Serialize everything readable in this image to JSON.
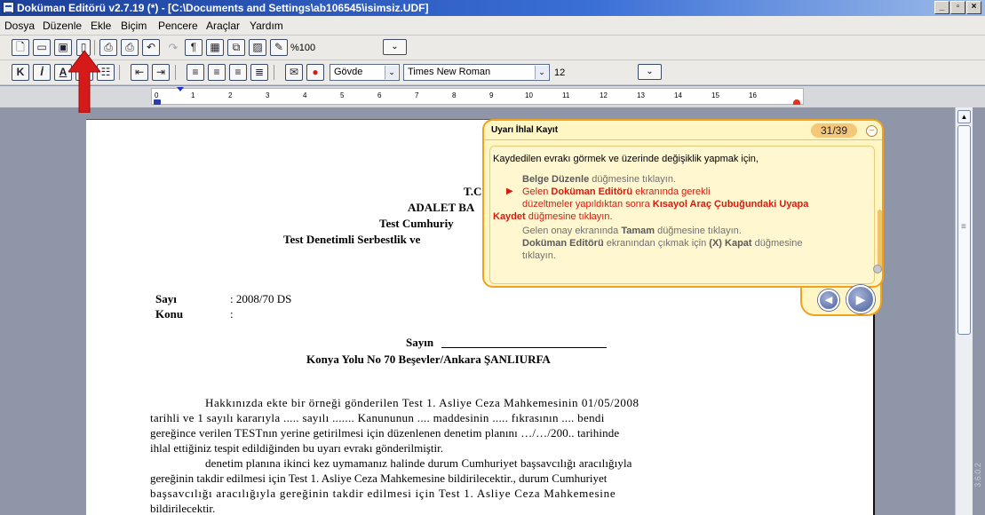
{
  "window": {
    "title": "Doküman Editörü v2.7.19 (*) - [C:\\Documents and Settings\\ab106545\\isimsiz.UDF]",
    "minimize": "_",
    "maximize": "▫",
    "close": "×"
  },
  "menu": [
    "Dosya",
    "Düzenle",
    "Ekle",
    "Biçim",
    "Pencere",
    "Araçlar",
    "Yardım"
  ],
  "toolbar1": {
    "zoom": "%100"
  },
  "toolbar2": {
    "bold": "K",
    "italic": "İ",
    "style_value": "Gövde",
    "font_value": "Times New Roman",
    "size_value": "12"
  },
  "ruler_numbers": [
    "0",
    "1",
    "2",
    "3",
    "4",
    "5",
    "6",
    "7",
    "8",
    "9",
    "10",
    "11",
    "12",
    "13",
    "14",
    "15",
    "16"
  ],
  "document": {
    "header1": "T.C",
    "header2": "ADALET BA",
    "header3": "Test Cumhuriy",
    "header4": "Test Denetimli Serbestlik ve",
    "sayi_label": "Sayı",
    "sayi_value": ": 2008/70 DS",
    "konu_label": "Konu",
    "konu_value": ":",
    "sayin": "Sayın",
    "address": "Konya Yolu No 70 Beşevler/Ankara ŞANLIURFA",
    "para1": [
      "Hakkınızda ekte bir örneği gönderilen Test 1. Asliye Ceza Mahkemesinin 01/05/2008",
      "tarihli ve 1 sayılı kararıyla ..... sayılı ....... Kanununun .... maddesinin ..... fıkrasının .... bendi",
      "gereğince verilen TESTnın yerine getirilmesi için düzenlenen denetim planını …/…/200.. tarihinde",
      "ihlal ettiğiniz tespit edildiğinden bu uyarı evrakı gönderilmiştir."
    ],
    "para2": [
      "denetim planına ikinci kez uymamanız halinde durum Cumhuriyet başsavcılığı aracılığıyla",
      "gereğinin takdir edilmesi için Test 1. Asliye Ceza Mahkemesine bildirilecektir., durum Cumhuriyet",
      "başsavcılığı aracılığıyla gereğinin takdir edilmesi için Test 1. Asliye Ceza Mahkemesine",
      "bildirilecektir."
    ]
  },
  "help": {
    "title": "Uyarı İhlal Kayıt",
    "counter": "31/39",
    "intro": "Kaydedilen evrakı görmek ve üzerinde değişiklik yapmak için,",
    "step1_bold": "Belge Düzenle",
    "step1_rest": " düğmesine tıklayın.",
    "step2_a": "Gelen ",
    "step2_bold": "Doküman Editörü",
    "step2_b": " ekranında gerekli",
    "step2_line2_a": "düzeltmeler yapıldıktan sonra ",
    "step2_line2_bold": "Kısayol Araç Çubuğundaki Uyapa",
    "step2_line3_bold": "Kaydet",
    "step2_line3_rest": " düğmesine tıklayın.",
    "step3_a": "Gelen onay ekranında ",
    "step3_bold": "Tamam",
    "step3_b": " düğmesine tıklayın.",
    "step4_bold1": "Doküman Editörü",
    "step4_a": " ekranından çıkmak için ",
    "step4_bold2": "(X) Kapat",
    "step4_b": " düğmesine",
    "step4_line2": "tıklayın."
  },
  "version": "3.6.0.2",
  "colors": {
    "accent_orange": "#f0a21f",
    "highlight_red": "#d41c0f",
    "title_blue": "#1c3f9a"
  }
}
